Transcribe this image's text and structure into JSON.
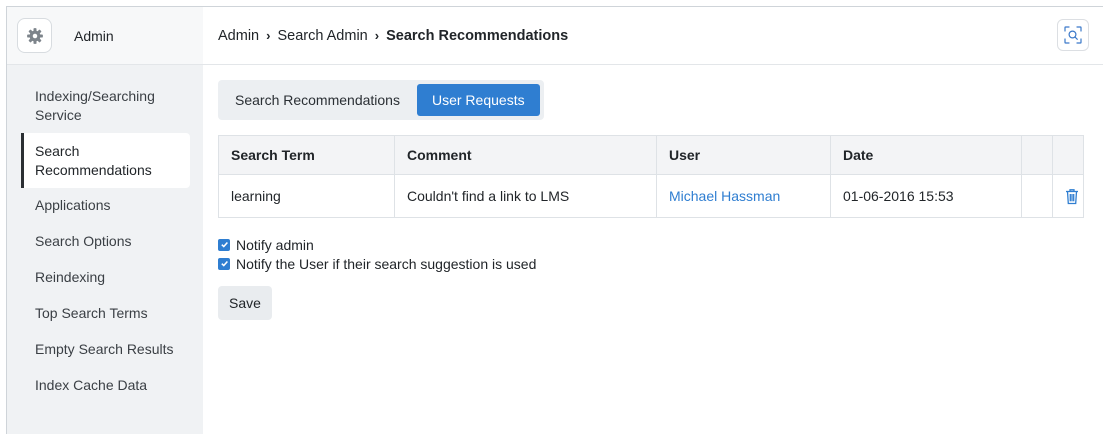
{
  "sidebar": {
    "app_title": "Admin",
    "app_icon": "gear-icon",
    "items": [
      {
        "label": "Indexing/Searching Service"
      },
      {
        "label": "Search Recommendations"
      },
      {
        "label": "Applications"
      },
      {
        "label": "Search Options"
      },
      {
        "label": "Reindexing"
      },
      {
        "label": "Top Search Terms"
      },
      {
        "label": "Empty Search Results"
      },
      {
        "label": "Index Cache Data"
      }
    ],
    "active_item": "Search Recommendations"
  },
  "header": {
    "breadcrumb": [
      "Admin",
      "Search Admin",
      "Search Recommendations"
    ],
    "separator": "›",
    "search_icon": "search-icon"
  },
  "tabs": [
    {
      "label": "Search Recommendations",
      "active": false
    },
    {
      "label": "User Requests",
      "active": true
    }
  ],
  "table": {
    "columns": [
      "Search Term",
      "Comment",
      "User",
      "Date",
      "",
      ""
    ],
    "rows": [
      {
        "term": "learning",
        "comment": "Couldn't find a link to LMS",
        "user": "Michael Hassman",
        "date": "01-06-2016 15:53",
        "action_icon": "trash-icon"
      }
    ]
  },
  "options": [
    {
      "label": "Notify admin",
      "checked": true
    },
    {
      "label": "Notify the User if their search suggestion is used",
      "checked": true
    }
  ],
  "save_label": "Save",
  "colors": {
    "accent": "#2f7ed1",
    "sidebar_bg": "#f0f2f4"
  }
}
